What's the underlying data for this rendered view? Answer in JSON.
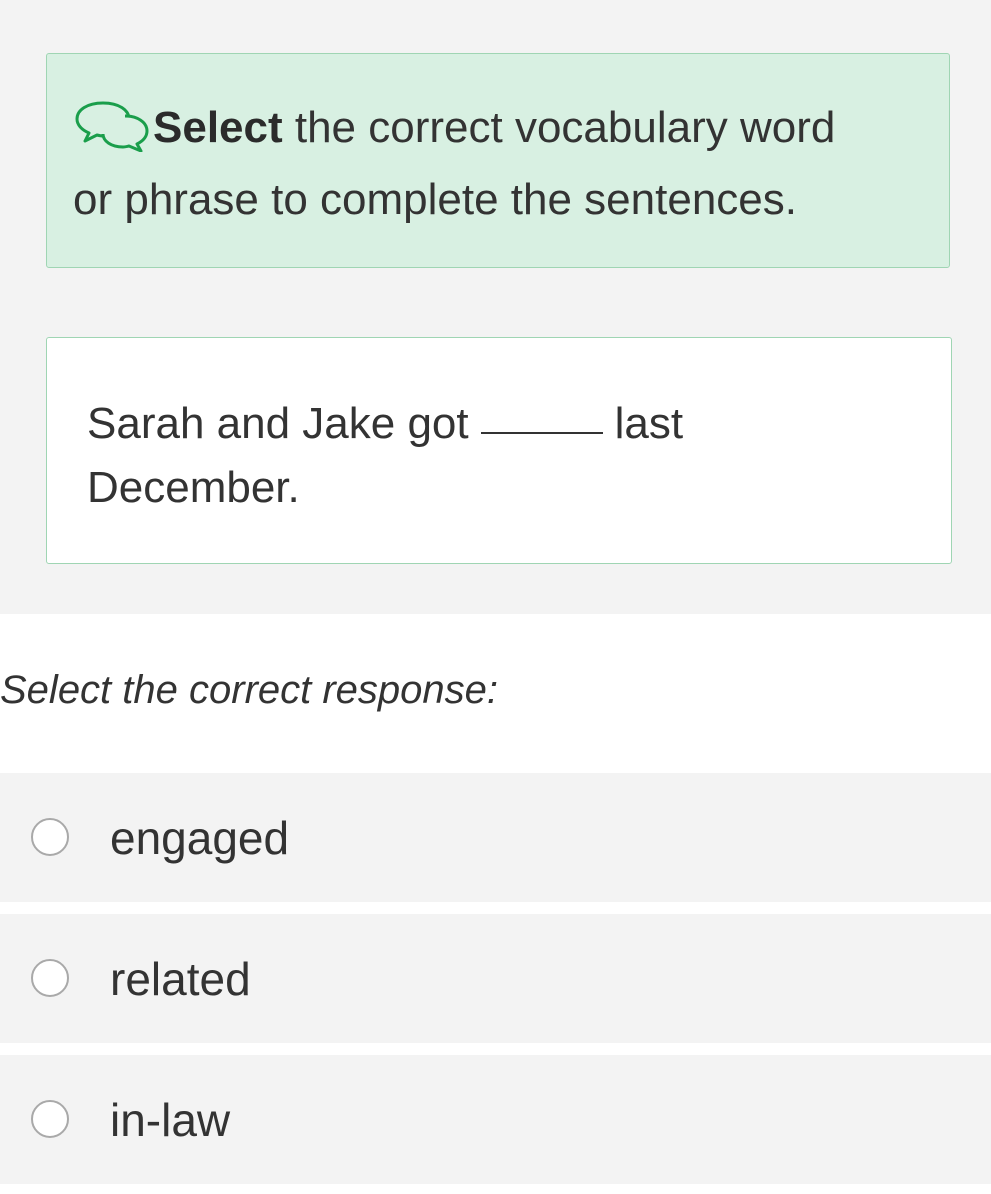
{
  "instruction": {
    "bold_text": "Select",
    "rest_line1": " the correct vocabulary word",
    "rest_line2": "or phrase to complete the sentences.",
    "icon": "speech-bubbles-icon",
    "accent_color": "#1a9e4b"
  },
  "question": {
    "before_blank": "Sarah and Jake got",
    "after_blank": "last",
    "line2": "December."
  },
  "prompt": "Select the correct response:",
  "options": [
    {
      "label": "engaged",
      "selected": false
    },
    {
      "label": "related",
      "selected": false
    },
    {
      "label": "in-law",
      "selected": false
    }
  ]
}
